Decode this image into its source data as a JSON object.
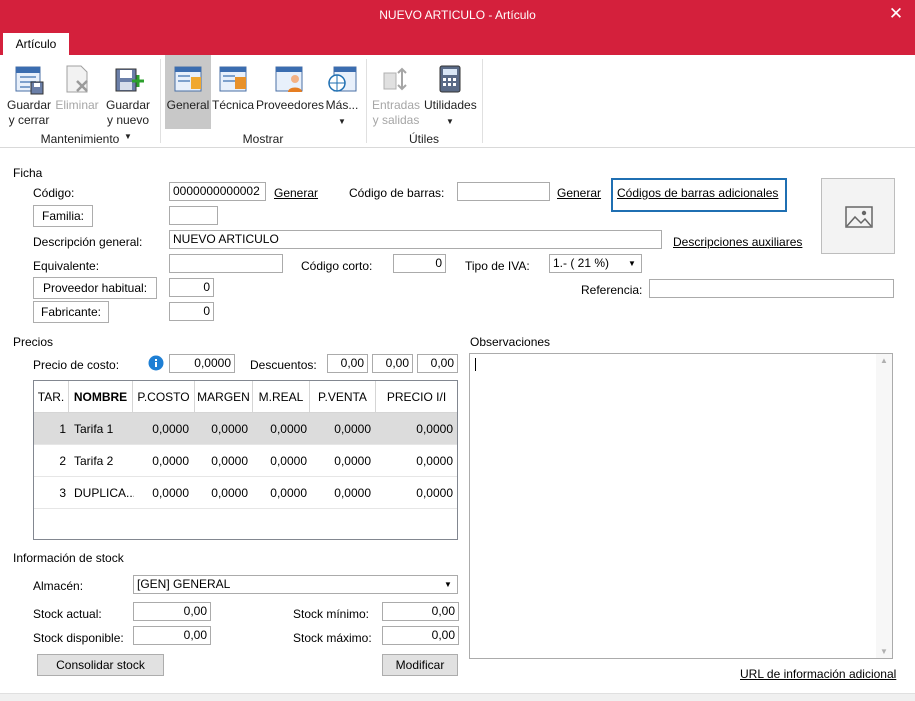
{
  "window": {
    "title": "NUEVO ARTICULO - Artículo",
    "close_glyph": "✕"
  },
  "tabs": [
    {
      "label": "Artículo"
    }
  ],
  "ribbon": {
    "guardar_cerrar": {
      "line1": "Guardar",
      "line2": "y cerrar",
      "icon": "save-close-icon"
    },
    "eliminar": {
      "line1": "Eliminar",
      "icon": "delete-icon"
    },
    "guardar_nuevo": {
      "line1": "Guardar",
      "line2": "y nuevo",
      "icon": "save-new-icon"
    },
    "general": {
      "line1": "General",
      "icon": "general-form-icon"
    },
    "tecnica": {
      "line1": "Técnica",
      "icon": "technical-form-icon"
    },
    "proveedores": {
      "line1": "Proveedores",
      "icon": "suppliers-icon"
    },
    "mas": {
      "line1": "Más...",
      "icon": "more-icon"
    },
    "entradas_salidas": {
      "line1": "Entradas",
      "line2": "y salidas",
      "icon": "in-out-icon"
    },
    "utilidades": {
      "line1": "Utilidades",
      "icon": "calculator-icon"
    },
    "groups": {
      "mantenimiento": "Mantenimiento",
      "mostrar": "Mostrar",
      "utiles": "Útiles"
    }
  },
  "ficha": {
    "section": "Ficha",
    "codigo_label": "Código:",
    "codigo_value": "0000000000002",
    "generar": "Generar",
    "codigo_barras_label": "Código de barras:",
    "codigo_barras_value": "",
    "generar2": "Generar",
    "codigos_adicionales": "Códigos de barras adicionales",
    "familia_btn": "Familia:",
    "familia_value": "",
    "descripcion_label": "Descripción general:",
    "descripcion_value": "NUEVO ARTICULO",
    "descripciones_aux": "Descripciones auxiliares",
    "equivalente_label": "Equivalente:",
    "equivalente_value": "",
    "codigo_corto_label": "Código corto:",
    "codigo_corto_value": "0",
    "tipo_iva_label": "Tipo de IVA:",
    "tipo_iva_value": "1.- ( 21 %)",
    "proveedor_btn": "Proveedor habitual:",
    "proveedor_value": "0",
    "referencia_label": "Referencia:",
    "referencia_value": "",
    "fabricante_btn": "Fabricante:",
    "fabricante_value": "0"
  },
  "precios": {
    "section": "Precios",
    "precio_costo_label": "Precio de costo:",
    "precio_costo_value": "0,0000",
    "descuentos_label": "Descuentos:",
    "descuentos": [
      "0,00",
      "0,00",
      "0,00"
    ],
    "columns": [
      "TAR.",
      "NOMBRE",
      "P.COSTO",
      "MARGEN",
      "M.REAL",
      "P.VENTA",
      "PRECIO I/I"
    ],
    "rows": [
      {
        "tar": "1",
        "nombre": "Tarifa 1",
        "pcosto": "0,0000",
        "margen": "0,0000",
        "mreal": "0,0000",
        "pventa": "0,0000",
        "precio_ii": "0,0000"
      },
      {
        "tar": "2",
        "nombre": "Tarifa 2",
        "pcosto": "0,0000",
        "margen": "0,0000",
        "mreal": "0,0000",
        "pventa": "0,0000",
        "precio_ii": "0,0000"
      },
      {
        "tar": "3",
        "nombre": "DUPLICA...",
        "pcosto": "0,0000",
        "margen": "0,0000",
        "mreal": "0,0000",
        "pventa": "0,0000",
        "precio_ii": "0,0000"
      }
    ]
  },
  "observaciones": {
    "section": "Observaciones",
    "value": "",
    "url_link": "URL de información adicional"
  },
  "stock": {
    "section": "Información de stock",
    "almacen_label": "Almacén:",
    "almacen_value": "[GEN] GENERAL",
    "stock_actual_label": "Stock actual:",
    "stock_actual_value": "0,00",
    "stock_minimo_label": "Stock mínimo:",
    "stock_minimo_value": "0,00",
    "stock_disponible_label": "Stock disponible:",
    "stock_disponible_value": "0,00",
    "stock_maximo_label": "Stock máximo:",
    "stock_maximo_value": "0,00",
    "consolidar_btn": "Consolidar stock",
    "modificar_btn": "Modificar"
  },
  "colors": {
    "accent": "#d4203c",
    "link_box": "#1f6fb2",
    "info": "#1e7fd4"
  }
}
